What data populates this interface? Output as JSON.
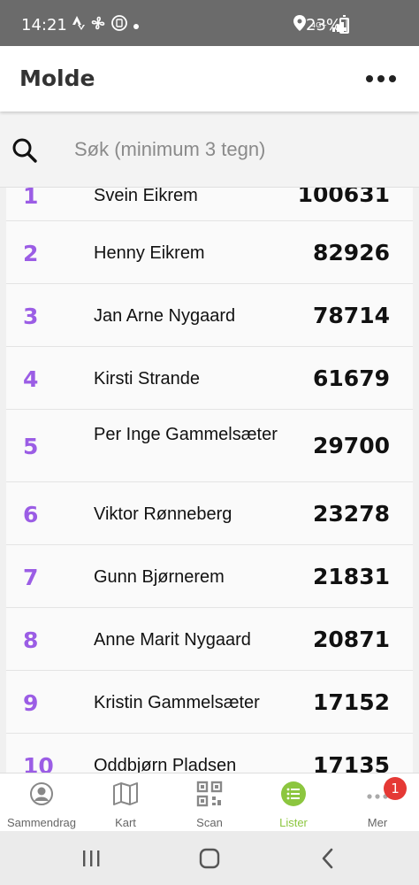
{
  "status_bar": {
    "time": "14:21",
    "left_icons": [
      "strava-icon",
      "fan-icon",
      "clipboard-icon",
      "dot-icon"
    ],
    "network": "4G+",
    "battery": "23%"
  },
  "header": {
    "title": "Molde",
    "more_icon": "more-horizontal-icon"
  },
  "search": {
    "placeholder": "Søk (minimum 3 tegn)",
    "value": ""
  },
  "list": {
    "rows": [
      {
        "rank": "1",
        "name": "Svein Eikrem",
        "score": "100631"
      },
      {
        "rank": "2",
        "name": "Henny Eikrem",
        "score": "82926"
      },
      {
        "rank": "3",
        "name": "Jan Arne Nygaard",
        "score": "78714"
      },
      {
        "rank": "4",
        "name": "Kirsti Strande",
        "score": "61679"
      },
      {
        "rank": "5",
        "name": "Per Inge Gammelsæter",
        "score": "29700"
      },
      {
        "rank": "6",
        "name": "Viktor Rønneberg",
        "score": "23278"
      },
      {
        "rank": "7",
        "name": "Gunn Bjørnerem",
        "score": "21831"
      },
      {
        "rank": "8",
        "name": "Anne Marit Nygaard",
        "score": "20871"
      },
      {
        "rank": "9",
        "name": "Kristin Gammelsæter",
        "score": "17152"
      },
      {
        "rank": "10",
        "name": "Oddbjørn Pladsen",
        "score": "17135"
      }
    ]
  },
  "bottom_nav": {
    "items": [
      {
        "label": "Sammendrag",
        "icon": "user-circle-icon"
      },
      {
        "label": "Kart",
        "icon": "map-icon"
      },
      {
        "label": "Scan",
        "icon": "qr-code-icon"
      },
      {
        "label": "Lister",
        "icon": "list-icon",
        "active": true
      },
      {
        "label": "Mer",
        "icon": "more-icon",
        "badge": "1"
      }
    ]
  },
  "colors": {
    "rank": "#9b5de5",
    "active_nav": "#8cc63f",
    "badge": "#e53935"
  }
}
